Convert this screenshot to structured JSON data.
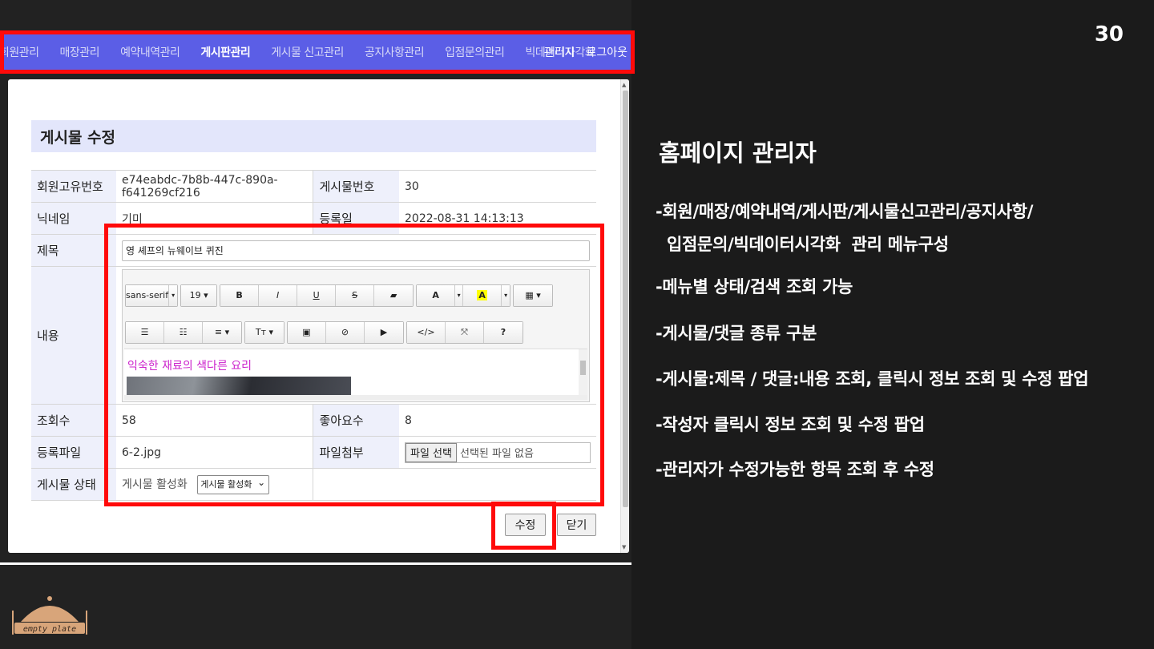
{
  "page_number": "30",
  "nav": {
    "items": [
      "회원관리",
      "매장관리",
      "예약내역관리",
      "게시판관리",
      "게시물 신고관리",
      "공지사항관리",
      "입점문의관리",
      "빅데이터시각화"
    ],
    "active_index": 3,
    "right": [
      "관리자",
      "로그아웃"
    ]
  },
  "form": {
    "title": "게시물 수정",
    "member_id_label": "회원고유번호",
    "member_id": "e74eabdc-7b8b-447c-890a-f641269cf216",
    "post_no_label": "게시물번호",
    "post_no": "30",
    "nickname_label": "닉네임",
    "nickname": "기미",
    "reg_date_label": "등록일",
    "reg_date": "2022-08-31 14:13:13",
    "subject_label": "제목",
    "subject": "영 셰프의 뉴웨이브 퀴진",
    "content_label": "내용",
    "content_text": "익숙한 재료의 색다른 요리",
    "views_label": "조회수",
    "views": "58",
    "likes_label": "좋아요수",
    "likes": "8",
    "file_label": "등록파일",
    "file_name": "6-2.jpg",
    "attach_label": "파일첨부",
    "attach_button": "파일 선택",
    "attach_status": "선택된 파일 없음",
    "status_label": "게시물 상태",
    "status_value": "게시물 활성화",
    "status_select": "게시물 활성화",
    "submit_button": "수정",
    "close_button": "닫기"
  },
  "editor": {
    "font_family": "sans-serif",
    "font_size": "19",
    "tools_row1": [
      "B",
      "I",
      "U",
      "S",
      "▰",
      "A",
      "A",
      "▦"
    ],
    "tools_row2": [
      "☰",
      "☷",
      "≡",
      "Tт",
      "▣",
      "⊘",
      "▶",
      "</>",
      "⤧",
      "?"
    ]
  },
  "colors": {
    "nav_bg": "#5b5ee6",
    "highlight_red": "#ff0a0a",
    "content_text": "#cc22cc"
  },
  "logo": {
    "text": "empty plate"
  },
  "right": {
    "heading": "홈페이지 관리자",
    "bullets": [
      "-회원/매장/예약내역/게시판/게시물신고관리/공지사항/",
      "  입점문의/빅데이터시각화  관리 메뉴구성",
      "-메뉴별 상태/검색 조회 가능",
      "-게시물/댓글 종류 구분",
      "-게시물:제목 / 댓글:내용 조회, 클릭시 정보 조회 및 수정 팝업",
      "-작성자 클릭시 정보 조회 및 수정 팝업",
      "-관리자가 수정가능한 항목 조회 후 수정"
    ]
  }
}
